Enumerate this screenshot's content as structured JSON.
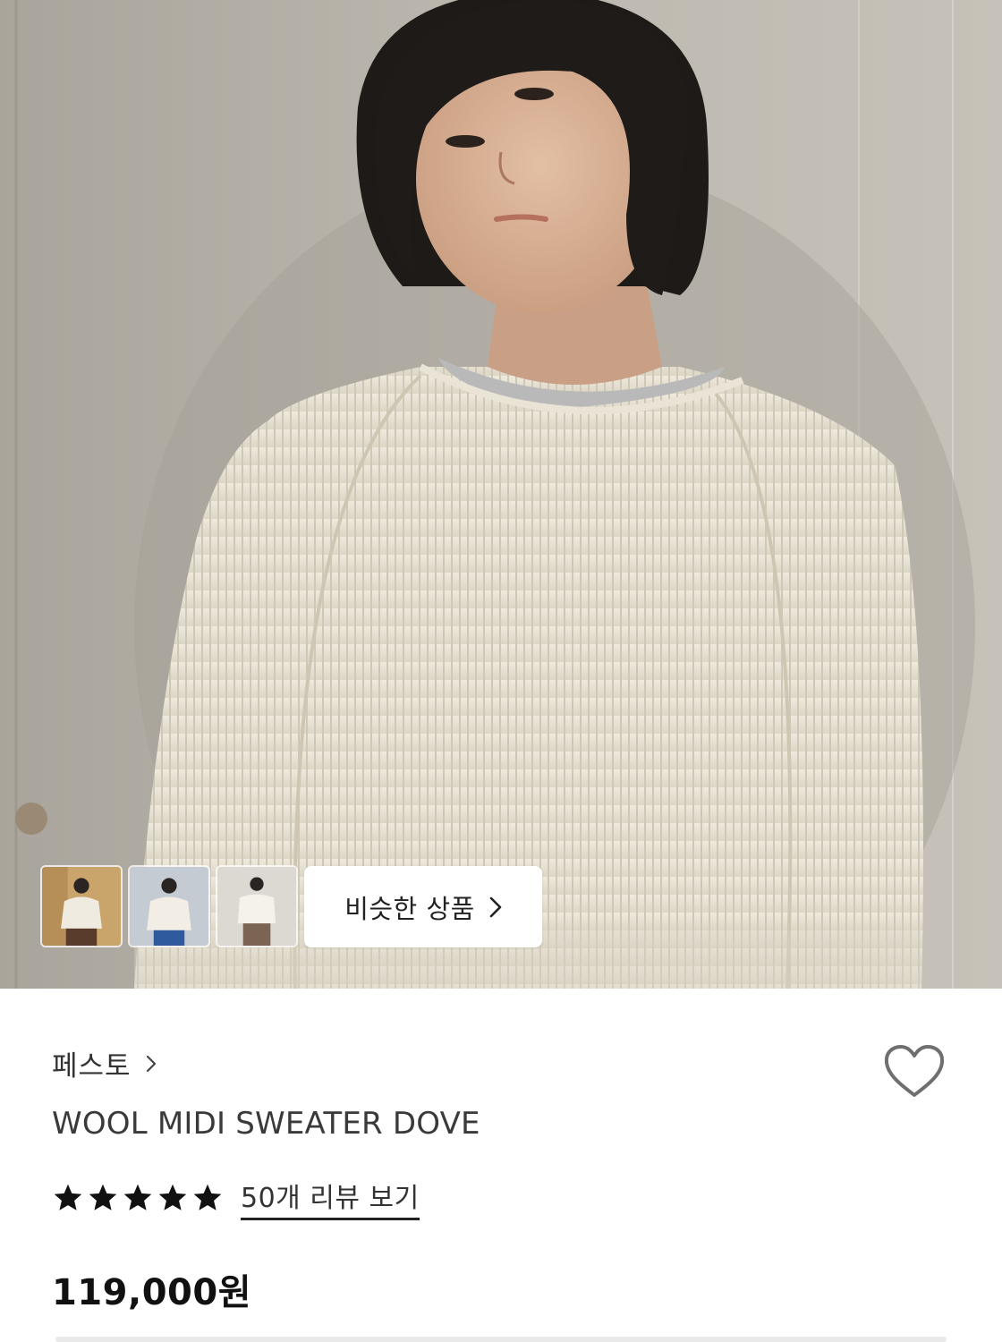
{
  "hero": {
    "photo_icon": "product-photo",
    "thumbnails": [
      {
        "icon": "thumbnail-photo-1"
      },
      {
        "icon": "thumbnail-photo-2"
      },
      {
        "icon": "thumbnail-photo-3"
      }
    ],
    "similar_label": "비슷한 상품",
    "similar_icon": "chevron-right-icon"
  },
  "product": {
    "brand": "페스토",
    "brand_icon": "chevron-right-icon",
    "name": "WOOL MIDI SWEATER DOVE",
    "wishlist_icon": "heart-icon",
    "rating": 5,
    "rating_max": 5,
    "review_link": "50개 리뷰 보기",
    "price": "119,000원"
  },
  "colors": {
    "text_primary": "#111111",
    "text_secondary": "#333333",
    "background": "#ffffff",
    "divider": "#e9e9e9"
  }
}
